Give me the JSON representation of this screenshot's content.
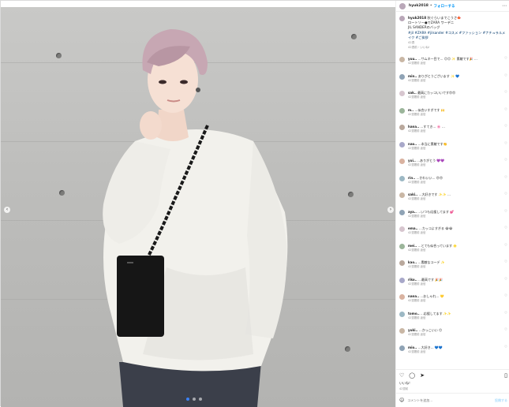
{
  "header": {
    "username": "hyuk2018",
    "separator": "•",
    "follow_label": "フォローする",
    "more_icon": "more-icon"
  },
  "caption": {
    "username": "hyuk2018",
    "line1": "秋ぐらいまでこうさ🍁",
    "line2": "ロートソー●でZARA ワーデニ",
    "line3": "JIL SANDERのバッグ",
    "tags": "#jil #ZARA #jilsander #コスメ #ファッション #ナチュラルメイク #ご挨拶",
    "time": "42週",
    "time_meta": "42週前・いいね!",
    "translate": "翻訳を見る"
  },
  "comments": [
    {
      "user": "yuu..",
      "text": "…サムネ一目で… 😊😊 ✨ 素敵です🎉 …",
      "sub": "42週間前 返信"
    },
    {
      "user": "min..",
      "text": "ありがとうございます ✨ 💙",
      "sub": "42週間前 返信"
    },
    {
      "user": "sak..",
      "text": "最高にカッコいいです😍😍",
      "sub": "42週間前 返信"
    },
    {
      "user": "m..",
      "text": "…似合いすぎです 🙌",
      "sub": "42週間前 返信"
    },
    {
      "user": "hana..",
      "text": "…すてき… 🌸 …",
      "sub": "42週間前 返信"
    },
    {
      "user": "nao..",
      "text": "…本当に素敵です👏",
      "sub": "42週間前 返信"
    },
    {
      "user": "yui..",
      "text": "…ありがとう 💜💜",
      "sub": "42週間前 返信"
    },
    {
      "user": "rin..",
      "text": "…かわいい… 😍😍",
      "sub": "42週間前 返信"
    },
    {
      "user": "saki..",
      "text": "…大好きです ✨✨ …",
      "sub": "42週間前 返信"
    },
    {
      "user": "aya..",
      "text": "…いつも応援してます 💕",
      "sub": "42週間前 返信"
    },
    {
      "user": "ema..",
      "text": "…カッコよすぎる 😭😭",
      "sub": "42週間前 返信"
    },
    {
      "user": "mei..",
      "text": "…とても似合っています 🌟",
      "sub": "42週間前 返信"
    },
    {
      "user": "kao..",
      "text": "…素敵なコーデ ✨",
      "sub": "42週間前 返信"
    },
    {
      "user": "riko..",
      "text": "…最高です 🎉🎉",
      "sub": "42週間前 返信"
    },
    {
      "user": "nana..",
      "text": "…おしゃれ… 💛",
      "sub": "42週間前 返信"
    },
    {
      "user": "tomo..",
      "text": "…応援してます ✨✨",
      "sub": "42週間前 返信"
    },
    {
      "user": "yuki..",
      "text": "…かっこいい 😊",
      "sub": "42週間前 返信"
    },
    {
      "user": "mio..",
      "text": "…大好き… 💙💙",
      "sub": "42週間前 返信"
    }
  ],
  "actions": {
    "heart_icon": "heart-icon",
    "comment_icon": "comment-icon",
    "share_icon": "share-icon",
    "save_icon": "bookmark-icon"
  },
  "likes": "いいね！",
  "date": "42週前",
  "composer": {
    "placeholder": "コメントを追加...",
    "post_label": "投稿する"
  },
  "photo": {
    "dots_total": 3,
    "dots_active": 1
  }
}
